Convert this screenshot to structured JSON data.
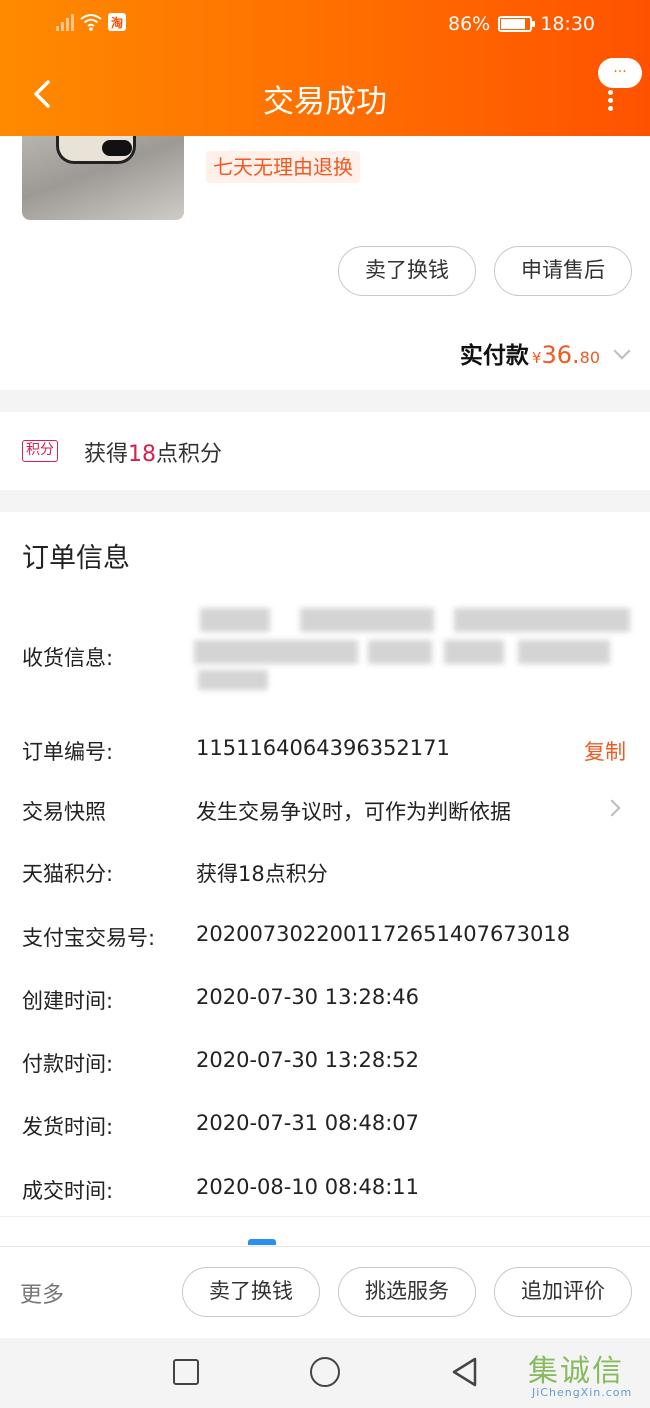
{
  "status_bar": {
    "carrier_badge": "淘",
    "battery_percent": "86%",
    "battery_level": 0.86,
    "time": "18:30"
  },
  "header": {
    "title": "交易成功",
    "more_bubble": "···",
    "back_icon": "chevron-left-icon"
  },
  "product": {
    "return_tag": "七天无理由退换",
    "actions": [
      "卖了换钱",
      "申请售后"
    ],
    "paid_label": "实付款",
    "paid_currency": "¥",
    "paid_integer": "36.",
    "paid_decimal": "80"
  },
  "points": {
    "tag": "积分",
    "prefix": "获得",
    "amount": "18",
    "suffix": "点积分"
  },
  "order": {
    "title": "订单信息",
    "shipping_label": "收货信息:",
    "order_no_label": "订单编号:",
    "order_no": "1151164064396352171",
    "copy_label": "复制",
    "snapshot_label": "交易快照",
    "snapshot_value": "发生交易争议时，可作为判断依据",
    "tmall_points_label": "天猫积分:",
    "tmall_points_value": "获得18点积分",
    "alipay_label": "支付宝交易号:",
    "alipay_value": "2020073022001172651407673018",
    "created_label": "创建时间:",
    "created_value": "2020-07-30 13:28:46",
    "paid_label": "付款时间:",
    "paid_value": "2020-07-30 13:28:52",
    "shipped_label": "发货时间:",
    "shipped_value": "2020-07-31 08:48:07",
    "completed_label": "成交时间:",
    "completed_value": "2020-08-10 08:48:11"
  },
  "bottom_bar": {
    "more": "更多",
    "buttons": [
      "卖了换钱",
      "挑选服务",
      "追加评价"
    ]
  },
  "watermark": {
    "logo": "集诚信",
    "url": "JiChengXin.com"
  },
  "colors": {
    "header_start": "#ff8a00",
    "header_end": "#ff5200",
    "accent_orange": "#f05a22",
    "points_red": "#d61f4f"
  }
}
